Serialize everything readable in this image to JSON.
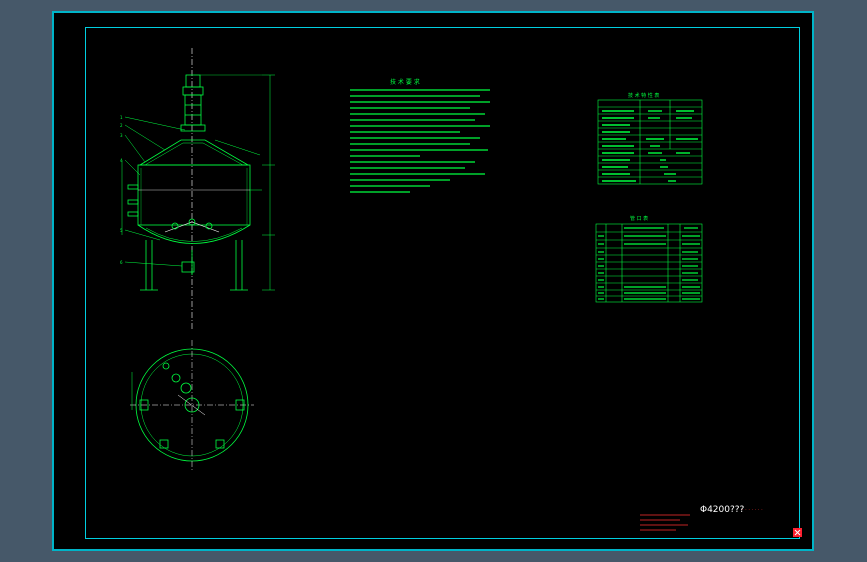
{
  "drawing": {
    "title_block_text": "Φ4200???",
    "red_note": "· · · · · · ·",
    "tech_requirements_heading": "技 术 要 求",
    "tech_spec_heading": "技 术 特 性 表",
    "nozzle_heading": "管  口  表",
    "tech_lines": 18,
    "spec_rows": 11,
    "nozzle_rows": 9
  },
  "colors": {
    "background": "#000000",
    "workspace": "#465869",
    "frame": "#00cfe0",
    "lines": "#00ff40",
    "text": "#00ff40",
    "dimensions": "#00ff40",
    "white_lines": "#ffffff",
    "red": "#ff3030"
  }
}
